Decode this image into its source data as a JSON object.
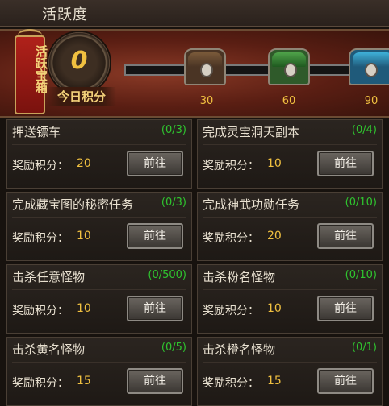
{
  "window": {
    "title": "活跃度"
  },
  "banner": {
    "badge_text": "活跃宝箱",
    "points_value": "0",
    "points_label": "今日积分",
    "chests": [
      {
        "threshold": "30",
        "color": "#4a3424"
      },
      {
        "threshold": "60",
        "color": "#2f5a2a"
      },
      {
        "threshold": "90",
        "color": "#1f5a7a"
      }
    ]
  },
  "reward_label": "奖励积分：",
  "tasks": [
    {
      "title": "押送镖车",
      "progress": "(0/3)",
      "reward": "20",
      "button": "前往"
    },
    {
      "title": "完成灵宝洞天副本",
      "progress": "(0/4)",
      "reward": "10",
      "button": "前往"
    },
    {
      "title": "完成藏宝图的秘密任务",
      "progress": "(0/3)",
      "reward": "10",
      "button": "前往"
    },
    {
      "title": "完成神武功勋任务",
      "progress": "(0/10)",
      "reward": "20",
      "button": "前往"
    },
    {
      "title": "击杀任意怪物",
      "progress": "(0/500)",
      "reward": "10",
      "button": "前往"
    },
    {
      "title": "击杀粉名怪物",
      "progress": "(0/10)",
      "reward": "10",
      "button": "前往"
    },
    {
      "title": "击杀黄名怪物",
      "progress": "(0/5)",
      "reward": "15",
      "button": "前往"
    },
    {
      "title": "击杀橙名怪物",
      "progress": "(0/1)",
      "reward": "15",
      "button": "前往"
    }
  ],
  "colors": {
    "progress_green": "#2fc42f",
    "value_gold": "#f0c040"
  }
}
